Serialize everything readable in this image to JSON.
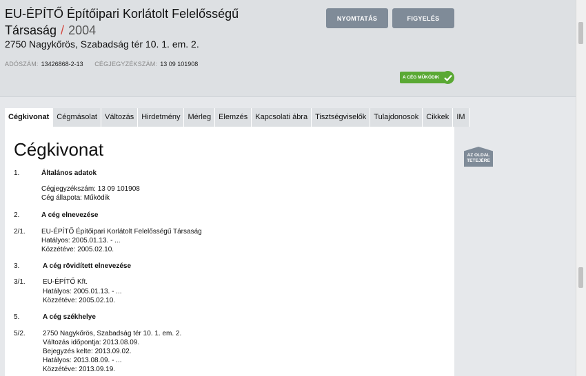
{
  "company": {
    "name": "EU-ÉPÍTŐ Építőipari Korlátolt Felelősségű Társaság",
    "separator": "/",
    "year": "2004",
    "address": "2750 Nagykőrös, Szabadság tér 10. 1. em. 2.",
    "tax_label": "ADÓSZÁM:",
    "tax_value": "13426868-2-13",
    "reg_label": "CÉGJEGYZÉKSZÁM:",
    "reg_value": "13 09 101908",
    "status_badge": "A CÉG MŰKÖDIK"
  },
  "buttons": {
    "print": "NYOMTATÁS",
    "watch": "FIGYELÉS",
    "to_top": "AZ OLDAL TETEJÉRE"
  },
  "tabs": [
    "Cégkivonat",
    "Cégmásolat",
    "Változás",
    "Hirdetmény",
    "Mérleg",
    "Elemzés",
    "Kapcsolati ábra",
    "Tisztségviselők",
    "Tulajdonosok",
    "Cikkek",
    "IM"
  ],
  "content": {
    "heading": "Cégkivonat",
    "s1_num": "1.",
    "s1_title": "Általános adatok",
    "s1_line1": "Cégjegyzékszám: 13 09 101908",
    "s1_line2": "Cég állapota: Működik",
    "s2_num": "2.",
    "s2_title": "A cég elnevezése",
    "s21_num": "2/1.",
    "s21_line1": "EU-ÉPÍTŐ Építőipari Korlátolt Felelősségű Társaság",
    "s21_line2": "Hatályos: 2005.01.13. - ...",
    "s21_line3": "Közzétéve: 2005.02.10.",
    "s3_num": "3.",
    "s3_title": "A cég rövidített elnevezése",
    "s31_num": "3/1.",
    "s31_line1": "EU-ÉPÍTŐ Kft.",
    "s31_line2": "Hatályos: 2005.01.13. - ...",
    "s31_line3": "Közzétéve: 2005.02.10.",
    "s5_num": "5.",
    "s5_title": "A cég székhelye",
    "s52_num": "5/2.",
    "s52_line1": "2750 Nagykőrös, Szabadság tér 10. 1. em. 2.",
    "s52_line2": "Változás időpontja: 2013.08.09.",
    "s52_line3": "Bejegyzés kelte: 2013.09.02.",
    "s52_line4": "Hatályos: 2013.08.09. - ...",
    "s52_line5": "Közzétéve: 2013.09.19."
  },
  "colors": {
    "accent_green": "#5aa934",
    "button_gray": "#7f8b98",
    "separator_red": "#d4453d"
  }
}
